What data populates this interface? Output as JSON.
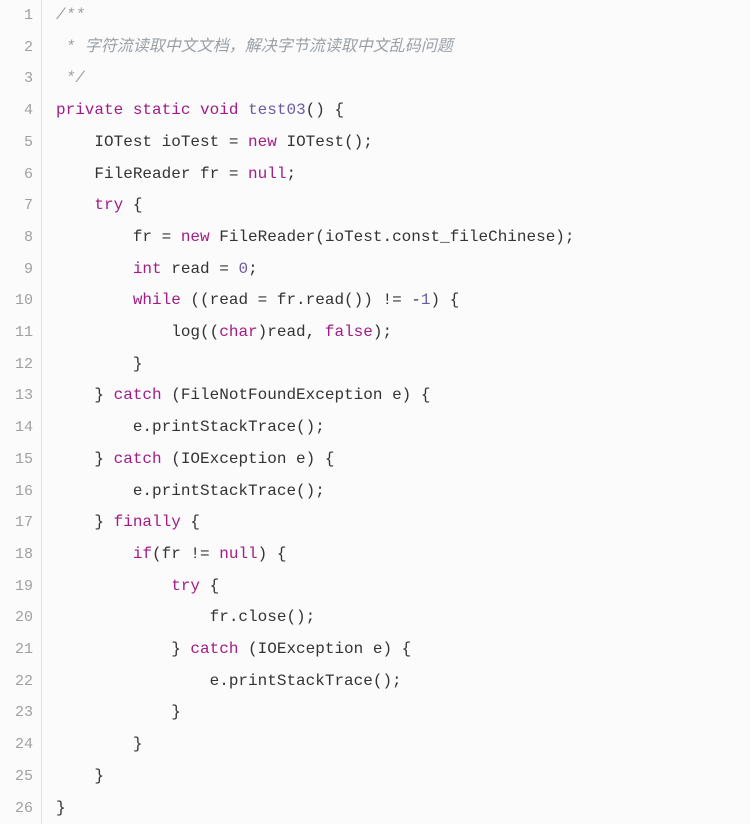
{
  "gutter": {
    "start": 1,
    "end": 26
  },
  "code": {
    "lines": [
      {
        "n": 1,
        "tokens": [
          {
            "c": "comment",
            "t": "/**"
          }
        ]
      },
      {
        "n": 2,
        "tokens": [
          {
            "c": "comment",
            "t": " * 字符流读取中文文档，解决字节流读取中文乱码问题"
          }
        ]
      },
      {
        "n": 3,
        "tokens": [
          {
            "c": "comment",
            "t": " */"
          }
        ]
      },
      {
        "n": 4,
        "tokens": [
          {
            "c": "keyword",
            "t": "private"
          },
          {
            "c": "punc",
            "t": " "
          },
          {
            "c": "keyword",
            "t": "static"
          },
          {
            "c": "punc",
            "t": " "
          },
          {
            "c": "keyword",
            "t": "void"
          },
          {
            "c": "punc",
            "t": " "
          },
          {
            "c": "method",
            "t": "test03"
          },
          {
            "c": "punc",
            "t": "() {"
          }
        ]
      },
      {
        "n": 5,
        "tokens": [
          {
            "c": "punc",
            "t": "    "
          },
          {
            "c": "type",
            "t": "IOTest"
          },
          {
            "c": "punc",
            "t": " "
          },
          {
            "c": "ident",
            "t": "ioTest"
          },
          {
            "c": "punc",
            "t": " = "
          },
          {
            "c": "new",
            "t": "new"
          },
          {
            "c": "punc",
            "t": " "
          },
          {
            "c": "class",
            "t": "IOTest"
          },
          {
            "c": "punc",
            "t": "();"
          }
        ]
      },
      {
        "n": 6,
        "tokens": [
          {
            "c": "punc",
            "t": "    "
          },
          {
            "c": "type",
            "t": "FileReader"
          },
          {
            "c": "punc",
            "t": " "
          },
          {
            "c": "ident",
            "t": "fr"
          },
          {
            "c": "punc",
            "t": " = "
          },
          {
            "c": "bool",
            "t": "null"
          },
          {
            "c": "punc",
            "t": ";"
          }
        ]
      },
      {
        "n": 7,
        "tokens": [
          {
            "c": "punc",
            "t": "    "
          },
          {
            "c": "keyword",
            "t": "try"
          },
          {
            "c": "punc",
            "t": " {"
          }
        ]
      },
      {
        "n": 8,
        "tokens": [
          {
            "c": "punc",
            "t": "        "
          },
          {
            "c": "ident",
            "t": "fr"
          },
          {
            "c": "punc",
            "t": " = "
          },
          {
            "c": "new",
            "t": "new"
          },
          {
            "c": "punc",
            "t": " "
          },
          {
            "c": "class",
            "t": "FileReader"
          },
          {
            "c": "punc",
            "t": "(ioTest.const_fileChinese);"
          }
        ]
      },
      {
        "n": 9,
        "tokens": [
          {
            "c": "punc",
            "t": "        "
          },
          {
            "c": "keyword",
            "t": "int"
          },
          {
            "c": "punc",
            "t": " "
          },
          {
            "c": "ident",
            "t": "read"
          },
          {
            "c": "punc",
            "t": " = "
          },
          {
            "c": "number",
            "t": "0"
          },
          {
            "c": "punc",
            "t": ";"
          }
        ]
      },
      {
        "n": 10,
        "tokens": [
          {
            "c": "punc",
            "t": "        "
          },
          {
            "c": "keyword",
            "t": "while"
          },
          {
            "c": "punc",
            "t": " ((read = fr.read()) != -"
          },
          {
            "c": "number",
            "t": "1"
          },
          {
            "c": "punc",
            "t": ") {"
          }
        ]
      },
      {
        "n": 11,
        "tokens": [
          {
            "c": "punc",
            "t": "            log(("
          },
          {
            "c": "cast",
            "t": "char"
          },
          {
            "c": "punc",
            "t": ")read, "
          },
          {
            "c": "bool",
            "t": "false"
          },
          {
            "c": "punc",
            "t": ");"
          }
        ]
      },
      {
        "n": 12,
        "tokens": [
          {
            "c": "punc",
            "t": "        }"
          }
        ]
      },
      {
        "n": 13,
        "tokens": [
          {
            "c": "punc",
            "t": "    } "
          },
          {
            "c": "keyword",
            "t": "catch"
          },
          {
            "c": "punc",
            "t": " (FileNotFoundException e) {"
          }
        ]
      },
      {
        "n": 14,
        "tokens": [
          {
            "c": "punc",
            "t": "        e.printStackTrace();"
          }
        ]
      },
      {
        "n": 15,
        "tokens": [
          {
            "c": "punc",
            "t": "    } "
          },
          {
            "c": "keyword",
            "t": "catch"
          },
          {
            "c": "punc",
            "t": " (IOException e) {"
          }
        ]
      },
      {
        "n": 16,
        "tokens": [
          {
            "c": "punc",
            "t": "        e.printStackTrace();"
          }
        ]
      },
      {
        "n": 17,
        "tokens": [
          {
            "c": "punc",
            "t": "    } "
          },
          {
            "c": "keyword",
            "t": "finally"
          },
          {
            "c": "punc",
            "t": " {"
          }
        ]
      },
      {
        "n": 18,
        "tokens": [
          {
            "c": "punc",
            "t": "        "
          },
          {
            "c": "keyword",
            "t": "if"
          },
          {
            "c": "punc",
            "t": "(fr != "
          },
          {
            "c": "bool",
            "t": "null"
          },
          {
            "c": "punc",
            "t": ") {"
          }
        ]
      },
      {
        "n": 19,
        "tokens": [
          {
            "c": "punc",
            "t": "            "
          },
          {
            "c": "keyword",
            "t": "try"
          },
          {
            "c": "punc",
            "t": " {"
          }
        ]
      },
      {
        "n": 20,
        "tokens": [
          {
            "c": "punc",
            "t": "                fr.close();"
          }
        ]
      },
      {
        "n": 21,
        "tokens": [
          {
            "c": "punc",
            "t": "            } "
          },
          {
            "c": "keyword",
            "t": "catch"
          },
          {
            "c": "punc",
            "t": " (IOException e) {"
          }
        ]
      },
      {
        "n": 22,
        "tokens": [
          {
            "c": "punc",
            "t": "                e.printStackTrace();"
          }
        ]
      },
      {
        "n": 23,
        "tokens": [
          {
            "c": "punc",
            "t": "            }"
          }
        ]
      },
      {
        "n": 24,
        "tokens": [
          {
            "c": "punc",
            "t": "        }"
          }
        ]
      },
      {
        "n": 25,
        "tokens": [
          {
            "c": "punc",
            "t": "    }"
          }
        ]
      },
      {
        "n": 26,
        "tokens": [
          {
            "c": "punc",
            "t": "}"
          }
        ]
      }
    ]
  }
}
